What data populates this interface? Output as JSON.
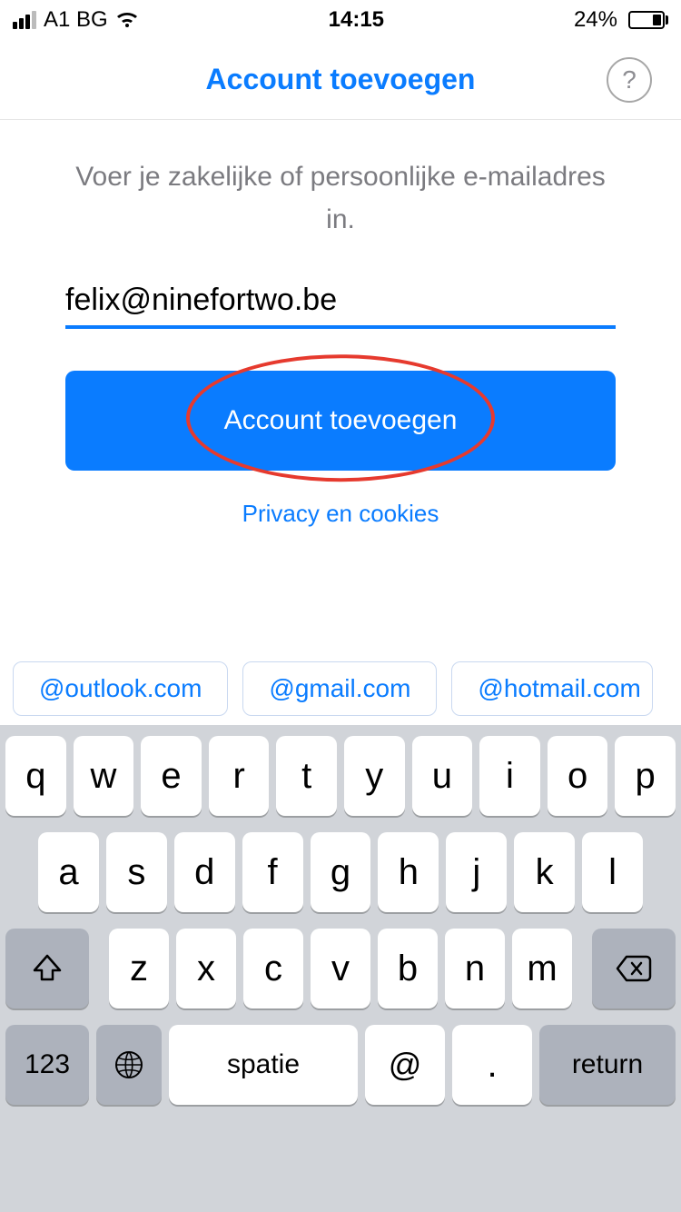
{
  "status": {
    "carrier": "A1 BG",
    "time": "14:15",
    "battery_pct": "24%"
  },
  "nav": {
    "title": "Account toevoegen",
    "help_glyph": "?"
  },
  "content": {
    "instruction": "Voer je zakelijke of persoonlijke e-mailadres in.",
    "email_value": "felix@ninefortwo.be",
    "submit_label": "Account toevoegen",
    "privacy_label": "Privacy en cookies"
  },
  "suggestions": [
    "@outlook.com",
    "@gmail.com",
    "@hotmail.com"
  ],
  "keyboard": {
    "row1": [
      "q",
      "w",
      "e",
      "r",
      "t",
      "y",
      "u",
      "i",
      "o",
      "p"
    ],
    "row2": [
      "a",
      "s",
      "d",
      "f",
      "g",
      "h",
      "j",
      "k",
      "l"
    ],
    "row3": [
      "z",
      "x",
      "c",
      "v",
      "b",
      "n",
      "m"
    ],
    "numbers_label": "123",
    "space_label": "spatie",
    "at_label": "@",
    "dot_label": ".",
    "return_label": "return"
  }
}
